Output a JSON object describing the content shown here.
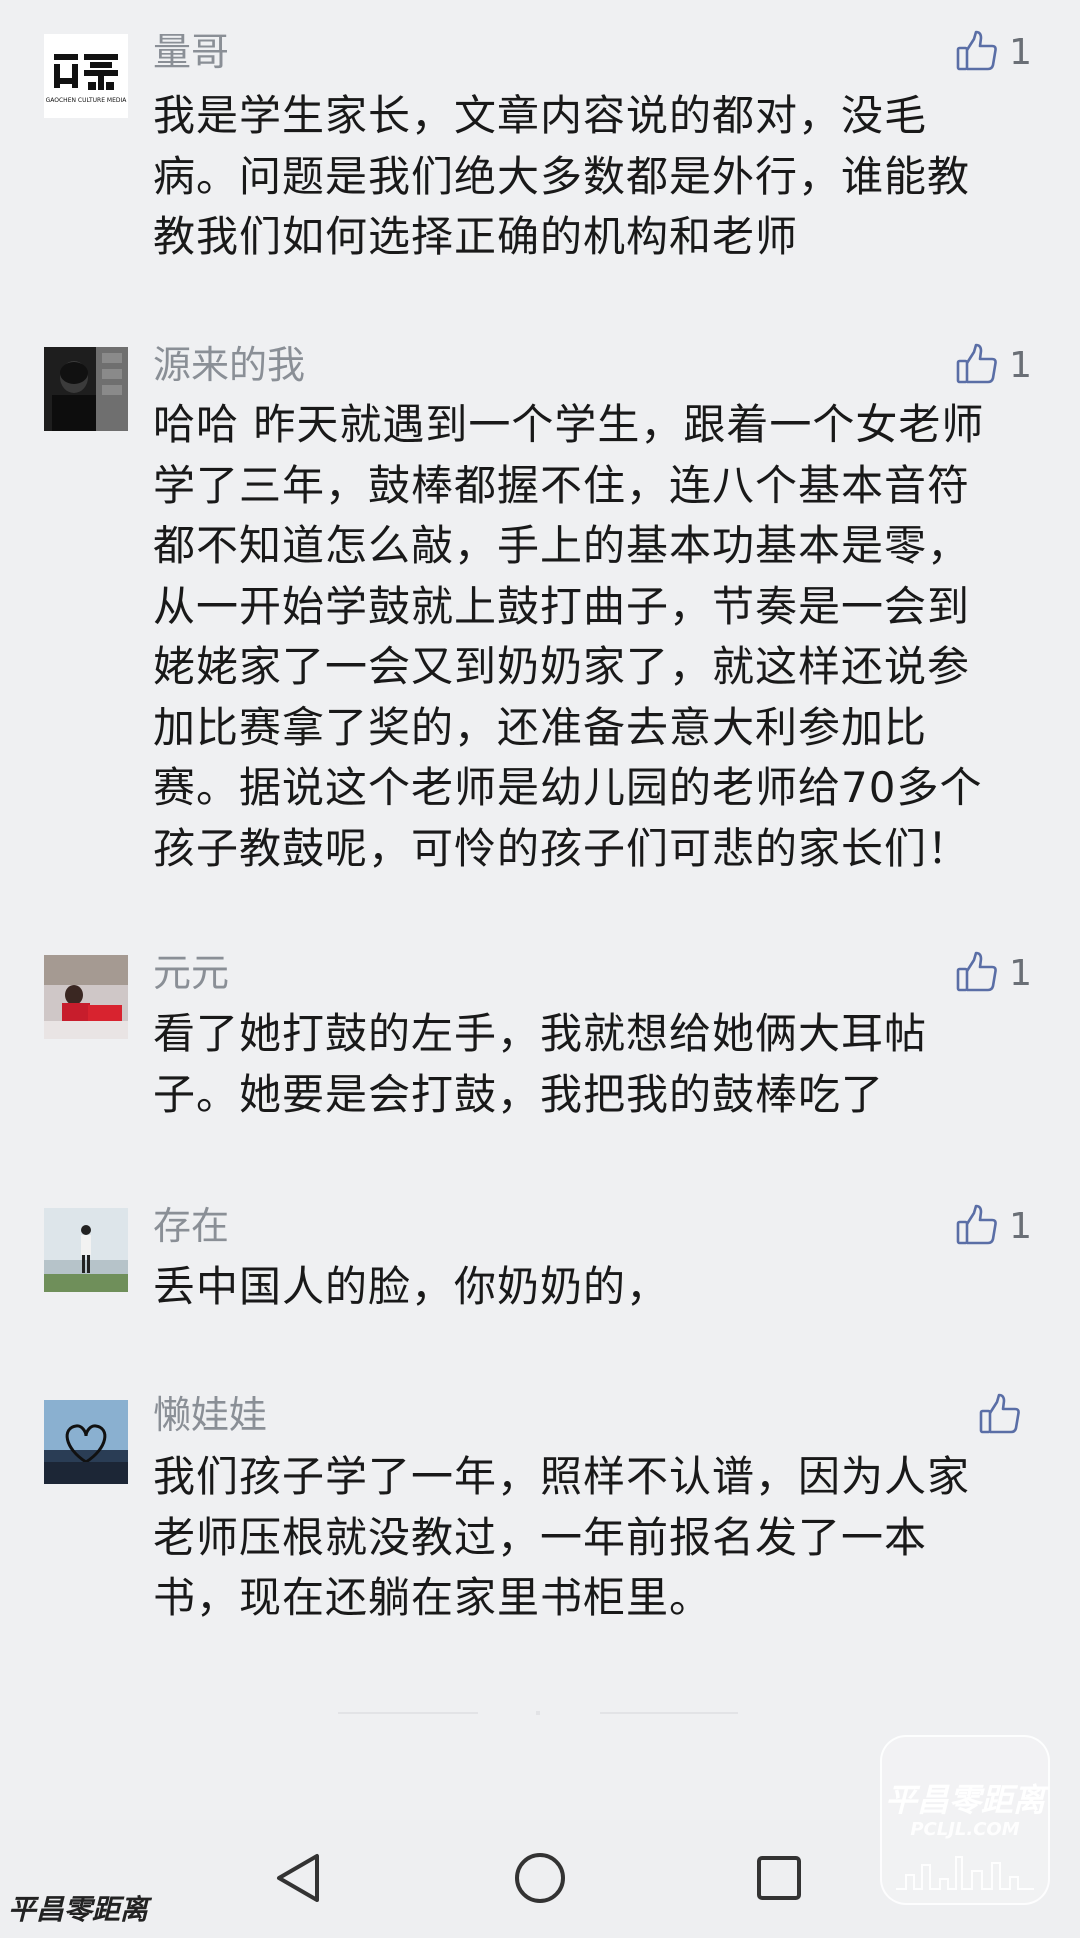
{
  "comments": [
    {
      "username": "量哥",
      "likes": "1",
      "lines": [
        "我是学生家长，文章内容说的都对，没毛",
        "病。问题是我们绝大多数都是外行，谁能教",
        "教我们如何选择正确的机构和老师"
      ],
      "avatar_logo_text": "GAOCHEN CULTURE MEDIA"
    },
    {
      "username": "源来的我",
      "likes": "1",
      "lines": [
        "哈哈 昨天就遇到一个学生，跟着一个女老师",
        "学了三年，鼓棒都握不住，连八个基本音符",
        "都不知道怎么敲，手上的基本功基本是零，",
        "从一开始学鼓就上鼓打曲子，节奏是一会到",
        "姥姥家了一会又到奶奶家了，就这样还说参",
        "加比赛拿了奖的，还准备去意大利参加比",
        "赛。据说这个老师是幼儿园的老师给70多个",
        "孩子教鼓呢，可怜的孩子们可悲的家长们！"
      ]
    },
    {
      "username": "元元",
      "likes": "1",
      "lines": [
        "看了她打鼓的左手，我就想给她俩大耳帖",
        "子。她要是会打鼓，我把我的鼓棒吃了"
      ]
    },
    {
      "username": "存在",
      "likes": "1",
      "lines": [
        "丢中国人的脸，你奶奶的，"
      ]
    },
    {
      "username": "懒娃娃",
      "likes": "",
      "lines": [
        "我们孩子学了一年，照样不认谱，因为人家",
        "老师压根就没教过，一年前报名发了一本",
        "书，现在还躺在家里书柜里。"
      ]
    }
  ],
  "watermark": {
    "title": "平昌零距离",
    "url": "PCLJL.COM",
    "corner": "平昌零距离"
  },
  "icons": {
    "like": "thumbs-up-icon",
    "back": "back-triangle-icon",
    "home": "home-circle-icon",
    "recents": "recents-square-icon"
  },
  "colors": {
    "background": "#eff0f2",
    "username": "#8a8f96",
    "text": "#191919",
    "icon": "#5a6ea6"
  }
}
